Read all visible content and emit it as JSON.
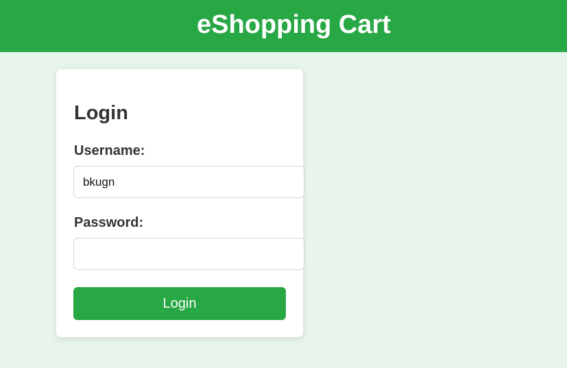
{
  "header": {
    "title": "eShopping Cart"
  },
  "login_form": {
    "title": "Login",
    "username_label": "Username:",
    "username_value": "bkugn",
    "password_label": "Password:",
    "password_value": "",
    "submit_label": "Login"
  },
  "colors": {
    "brand_green": "#28a745",
    "page_background": "#e8f5ec",
    "card_background": "#ffffff",
    "text_dark": "#333333"
  }
}
